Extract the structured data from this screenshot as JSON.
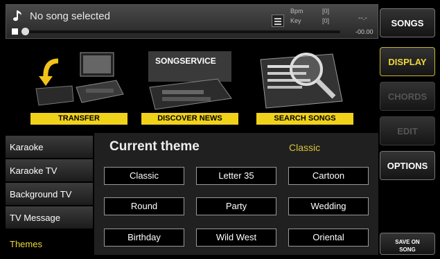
{
  "player": {
    "song_title": "No song selected",
    "bpm_label": "Bpm",
    "bpm_value": "[0]",
    "key_label": "Key",
    "key_value": "[0]",
    "time_elapsed": "--.-",
    "time_remaining": "-00.00",
    "progress": 0
  },
  "right_menu": {
    "songs": "SONGS",
    "display": "DISPLAY",
    "chords": "CHORDS",
    "edit": "EDIT",
    "options": "OPTIONS",
    "save_line1": "SAVE ON",
    "save_line2": "SONG"
  },
  "banner": {
    "transfer": "TRANSFER",
    "discover": "DISCOVER NEWS",
    "search": "SEARCH SONGS",
    "songservice_logo": "SONGSERVICE"
  },
  "sidebar": {
    "items": [
      {
        "label": "Karaoke"
      },
      {
        "label": "Karaoke TV"
      },
      {
        "label": "Background TV"
      },
      {
        "label": "TV Message"
      },
      {
        "label": "Themes"
      }
    ]
  },
  "themes": {
    "title": "Current theme",
    "current": "Classic",
    "buttons": [
      "Classic",
      "Letter 35",
      "Cartoon",
      "Round",
      "Party",
      "Wedding",
      "Birthday",
      "Wild West",
      "Oriental"
    ]
  },
  "colors": {
    "accent": "#f1d73a",
    "banner_label": "#f1d21a"
  }
}
